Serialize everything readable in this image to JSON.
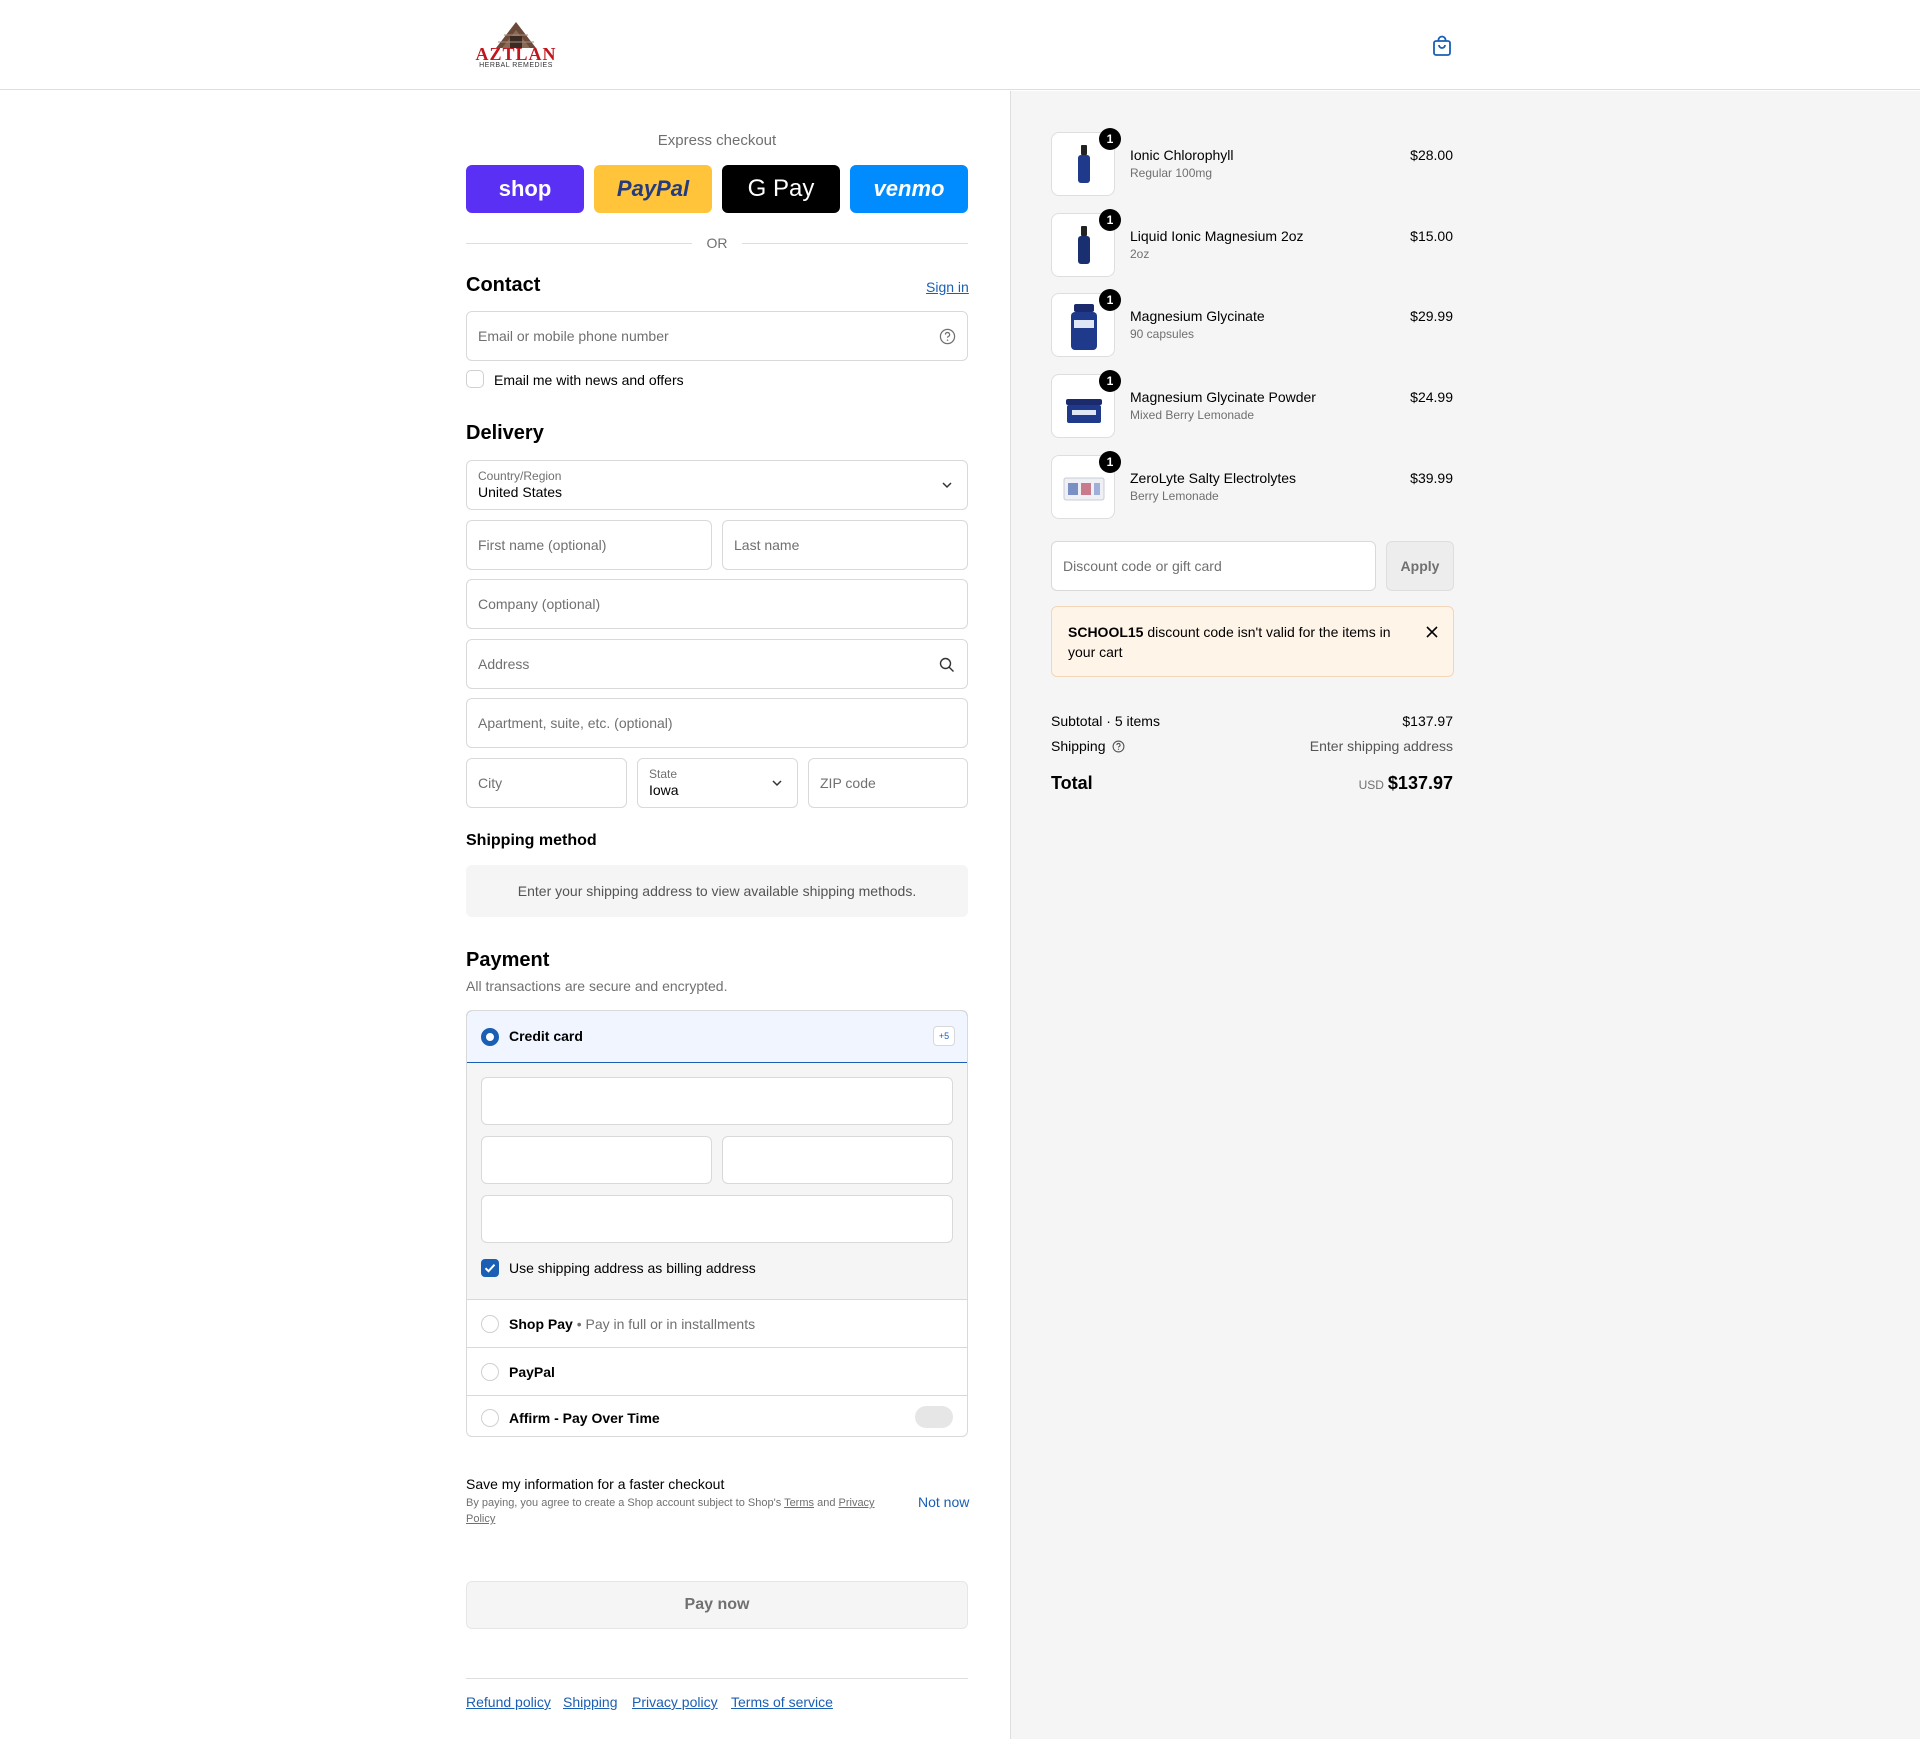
{
  "brand": {
    "logo_text": "AZTLAN",
    "logo_subtext": "HERBAL REMEDIES"
  },
  "express": {
    "title": "Express checkout",
    "buttons": [
      {
        "label": "shop",
        "color": "#5a31f4"
      },
      {
        "label": "PayPal",
        "color": "#ffc439"
      },
      {
        "label": "G Pay",
        "color": "#000000"
      },
      {
        "label": "venmo",
        "color": "#008cff"
      }
    ],
    "or": "OR"
  },
  "contact": {
    "heading": "Contact",
    "sign_in": "Sign in",
    "email_placeholder": "Email or mobile phone number",
    "newsletter_label": "Email me with news and offers"
  },
  "delivery": {
    "heading": "Delivery",
    "country_label": "Country/Region",
    "country_value": "United States",
    "first_name_placeholder": "First name (optional)",
    "last_name_placeholder": "Last name",
    "company_placeholder": "Company (optional)",
    "address_placeholder": "Address",
    "apartment_placeholder": "Apartment, suite, etc. (optional)",
    "city_placeholder": "City",
    "state_label": "State",
    "state_value": "Iowa",
    "zip_placeholder": "ZIP code"
  },
  "shipping_method": {
    "heading": "Shipping method",
    "notice": "Enter your shipping address to view available shipping methods."
  },
  "payment": {
    "heading": "Payment",
    "subtitle": "All transactions are secure and encrypted.",
    "credit_card": "Credit card",
    "more_badge": "+5",
    "billing_label": "Use shipping address as billing address",
    "shop_pay": "Shop Pay",
    "shop_pay_sub": "Pay in full or in installments",
    "paypal": "PayPal",
    "affirm": "Affirm - Pay Over Time"
  },
  "save_info": {
    "title": "Save my information for a faster checkout",
    "terms_prefix": "By paying, you agree to create a Shop account subject to Shop's",
    "terms_link": "Terms",
    "and": "and",
    "privacy_link": "Privacy Policy",
    "not_now": "Not now"
  },
  "pay_now": "Pay now",
  "footer_links": [
    "Refund policy",
    "Shipping",
    "Privacy policy",
    "Terms of service"
  ],
  "cart": {
    "items": [
      {
        "name": "Ionic Chlorophyll",
        "variant": "Regular 100mg",
        "price": "$28.00",
        "qty": "1"
      },
      {
        "name": "Liquid Ionic Magnesium 2oz",
        "variant": "2oz",
        "price": "$15.00",
        "qty": "1"
      },
      {
        "name": "Magnesium Glycinate",
        "variant": "90 capsules",
        "price": "$29.99",
        "qty": "1"
      },
      {
        "name": "Magnesium Glycinate Powder",
        "variant": "Mixed Berry Lemonade",
        "price": "$24.99",
        "qty": "1"
      },
      {
        "name": "ZeroLyte Salty Electrolytes",
        "variant": "Berry Lemonade",
        "price": "$39.99",
        "qty": "1"
      }
    ],
    "discount_placeholder": "Discount code or gift card",
    "apply": "Apply",
    "error_code": "SCHOOL15",
    "error_text": "discount code isn't valid for the items in your cart",
    "subtotal_label": "Subtotal · 5 items",
    "subtotal_value": "$137.97",
    "shipping_label": "Shipping",
    "shipping_value": "Enter shipping address",
    "total_label": "Total",
    "currency": "USD",
    "total_value": "$137.97"
  }
}
